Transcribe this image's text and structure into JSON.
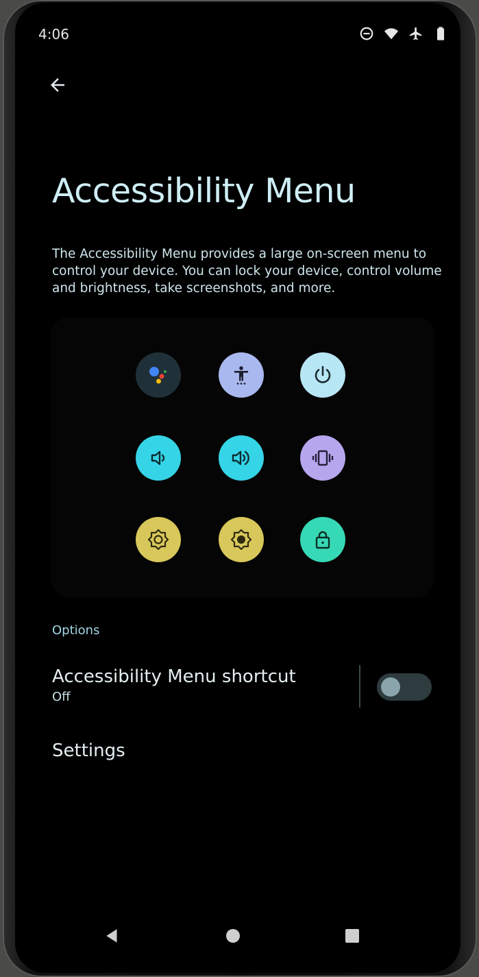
{
  "status_bar": {
    "time": "4:06",
    "icons": [
      "do-not-disturb-icon",
      "wifi-icon",
      "airplane-mode-icon",
      "battery-icon"
    ]
  },
  "header": {
    "title": "Accessibility Menu",
    "description": "The Accessibility Menu provides a large on-screen menu to control your device. You can lock your device, control volume and brightness, take screenshots, and more."
  },
  "menu_preview": {
    "buttons": [
      {
        "icon": "google-assistant-icon",
        "color": "#203038"
      },
      {
        "icon": "accessibility-settings-icon",
        "color": "#a9b8ee"
      },
      {
        "icon": "power-icon",
        "color": "#b7e6f4"
      },
      {
        "icon": "volume-down-icon",
        "color": "#35d4e6"
      },
      {
        "icon": "volume-up-icon",
        "color": "#35d4e6"
      },
      {
        "icon": "vibrate-icon",
        "color": "#b6a6ee"
      },
      {
        "icon": "brightness-down-icon",
        "color": "#d8c75a"
      },
      {
        "icon": "brightness-up-icon",
        "color": "#d8c75a"
      },
      {
        "icon": "lock-icon",
        "color": "#36d9b5"
      }
    ]
  },
  "options": {
    "section_label": "Options",
    "shortcut": {
      "title": "Accessibility Menu shortcut",
      "summary": "Off",
      "enabled": false
    },
    "settings": {
      "title": "Settings"
    }
  },
  "nav_bar": {
    "buttons": [
      "back-nav-icon",
      "home-nav-icon",
      "recents-nav-icon"
    ]
  },
  "colors": {
    "background": "#000000",
    "title_text": "#cdeef4",
    "accent": "#9fd6e3"
  }
}
